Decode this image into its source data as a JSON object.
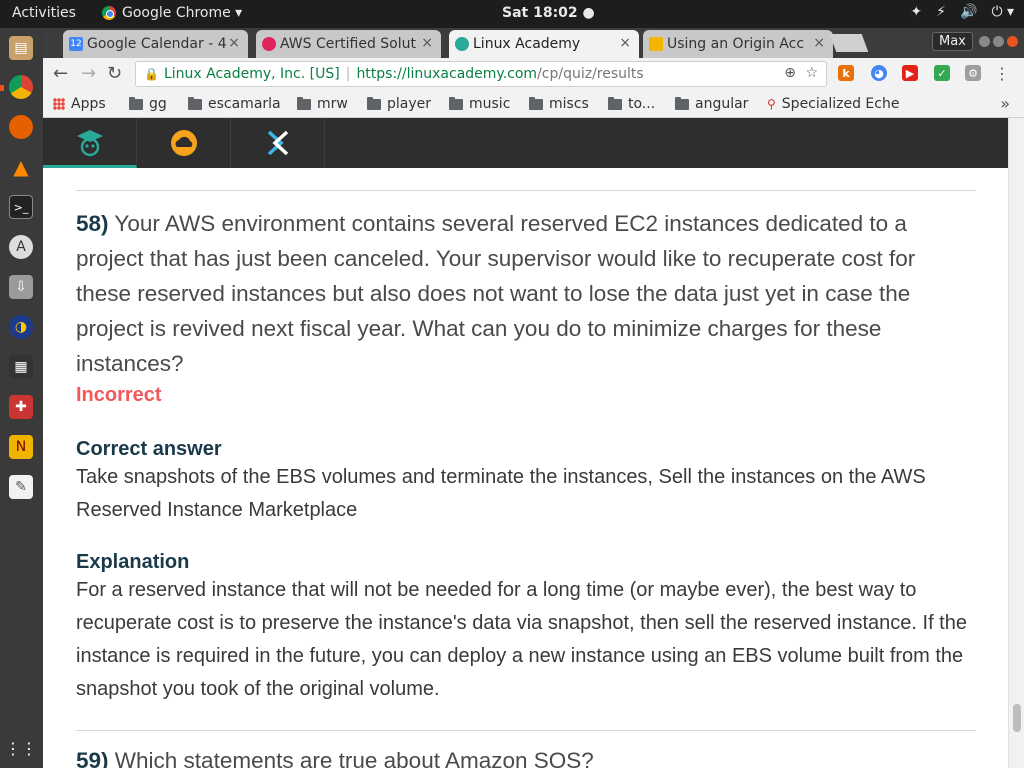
{
  "topbar": {
    "activities": "Activities",
    "app_name": "Google Chrome ▾",
    "clock": "Sat 18:02 ●",
    "tray": [
      "✦",
      "⚡",
      "🔊",
      "⏻ ▾"
    ]
  },
  "chrome": {
    "tabs": [
      {
        "title": "Google Calendar - 4",
        "favicon_color": "#4285f4",
        "favicon_text": "12"
      },
      {
        "title": "AWS Certified Solut",
        "favicon_color": "#e0245e",
        "favicon_text": ""
      },
      {
        "title": "Linux Academy",
        "favicon_color": "#2aa89a",
        "favicon_text": ""
      },
      {
        "title": "Using an Origin Acc",
        "favicon_color": "#f4b400",
        "favicon_text": ""
      }
    ],
    "close_glyph": "×",
    "max_label": "Max",
    "nav": {
      "back": "←",
      "forward": "→",
      "reload": "↻"
    },
    "omnibox": {
      "lock": "🔒",
      "security_label": "Linux Academy, Inc. [US]",
      "url_host": "https://linuxacademy.com",
      "url_path": "/cp/quiz/results",
      "zoom": "⊕",
      "star": "☆"
    },
    "extensions": [
      {
        "name": "k-icon",
        "label": "k",
        "color": "#e8710a"
      },
      {
        "name": "chart-icon",
        "label": "◕",
        "color": "#4285f4"
      },
      {
        "name": "youtube-icon",
        "label": "▶",
        "color": "#e62117"
      },
      {
        "name": "shield-icon",
        "label": "✓",
        "color": "#34a853"
      },
      {
        "name": "settings-ext-icon",
        "label": "⚙",
        "color": "#9e9e9e"
      }
    ],
    "menu": "⋮",
    "bookmarks": [
      {
        "label": "Apps",
        "kind": "apps"
      },
      {
        "label": "gg",
        "kind": "folder"
      },
      {
        "label": "escamarla",
        "kind": "folder"
      },
      {
        "label": "mrw",
        "kind": "folder"
      },
      {
        "label": "player",
        "kind": "folder"
      },
      {
        "label": "music",
        "kind": "folder"
      },
      {
        "label": "miscs",
        "kind": "folder"
      },
      {
        "label": "to...",
        "kind": "folder"
      },
      {
        "label": "angular",
        "kind": "folder"
      },
      {
        "label": "Specialized Eche",
        "kind": "site"
      }
    ],
    "bookmarks_more": "»"
  },
  "quiz": {
    "question_number": "58)",
    "question_text": "Your AWS environment contains several reserved EC2 instances dedicated to a project that has just been canceled. Your supervisor would like to recuperate cost for these reserved instances but also does not want to lose the data just yet in case the project is revived next fiscal year. What can you do to minimize charges for these instances?",
    "status": "Incorrect",
    "correct_answer_heading": "Correct answer",
    "correct_answer_text": "Take snapshots of the EBS volumes and terminate the instances, Sell the instances on the AWS Reserved Instance Marketplace",
    "explanation_heading": "Explanation",
    "explanation_text": "For a reserved instance that will not be needed for a long time (or maybe ever), the best way to recuperate cost is to preserve the instance's data via snapshot, then sell the reserved instance. If the instance is required in the future, you can deploy a new instance using an EBS volume built from the snapshot you took of the original volume.",
    "next_question_number": "59)",
    "next_question_text": "Which statements are true about Amazon SQS?"
  },
  "colors": {
    "incorrect": "#f05a5a",
    "heading": "#1a3a4a",
    "accent": "#2aa89a",
    "secure_green": "#0b8043"
  }
}
